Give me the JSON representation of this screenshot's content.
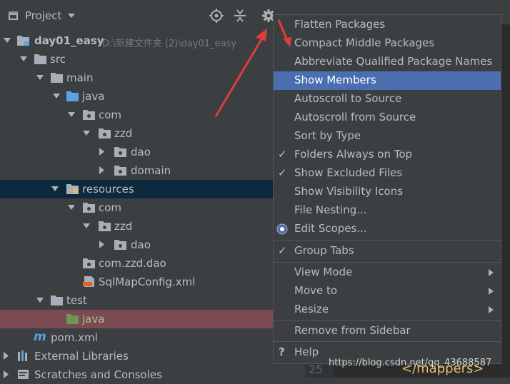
{
  "header": {
    "title": "Project"
  },
  "tree": {
    "rows": [
      {
        "label": "day01_easy",
        "path": "D:\\新建文件夹 (2)\\day01_easy"
      },
      {
        "label": "src"
      },
      {
        "label": "main"
      },
      {
        "label": "java"
      },
      {
        "label": "com"
      },
      {
        "label": "zzd"
      },
      {
        "label": "dao"
      },
      {
        "label": "domain"
      },
      {
        "label": "resources"
      },
      {
        "label": "com"
      },
      {
        "label": "zzd"
      },
      {
        "label": "dao"
      },
      {
        "label": "com.zzd.dao"
      },
      {
        "label": "SqlMapConfig.xml"
      },
      {
        "label": "test"
      },
      {
        "label": "java"
      },
      {
        "label": "pom.xml"
      },
      {
        "label": "External Libraries"
      },
      {
        "label": "Scratches and Consoles"
      }
    ]
  },
  "menu": {
    "items": [
      {
        "label": "Flatten Packages"
      },
      {
        "label": "Compact Middle Packages"
      },
      {
        "label": "Abbreviate Qualified Package Names"
      },
      {
        "label": "Show Members"
      },
      {
        "label": "Autoscroll to Source"
      },
      {
        "label": "Autoscroll from Source"
      },
      {
        "label": "Sort by Type"
      },
      {
        "label": "Folders Always on Top"
      },
      {
        "label": "Show Excluded Files"
      },
      {
        "label": "Show Visibility Icons"
      },
      {
        "label": "File Nesting..."
      },
      {
        "label": "Edit Scopes..."
      },
      {
        "label": "Group Tabs"
      },
      {
        "label": "View Mode"
      },
      {
        "label": "Move to"
      },
      {
        "label": "Resize"
      },
      {
        "label": "Remove from Sidebar"
      },
      {
        "label": "Help"
      }
    ],
    "check_glyph": "✓",
    "help_glyph": "?"
  },
  "editor": {
    "line_number": "25",
    "code_text": "</mappers>"
  },
  "watermark": "https://blog.csdn.net/qq_43688587",
  "colors": {
    "panel_bg": "#3c3f41",
    "selection": "#0d293e",
    "menu_highlight": "#4b6eaf",
    "excluded_row": "#7c4a52",
    "annotation_arrow": "#e03c3c",
    "folder_blue": "#5aa3e0",
    "folder_gray": "#a7b0b9"
  },
  "icons": {
    "project": "project-folder-icon",
    "locate": "crosshair-icon",
    "collapse": "collapse-all-icon",
    "settings": "gear-icon"
  }
}
